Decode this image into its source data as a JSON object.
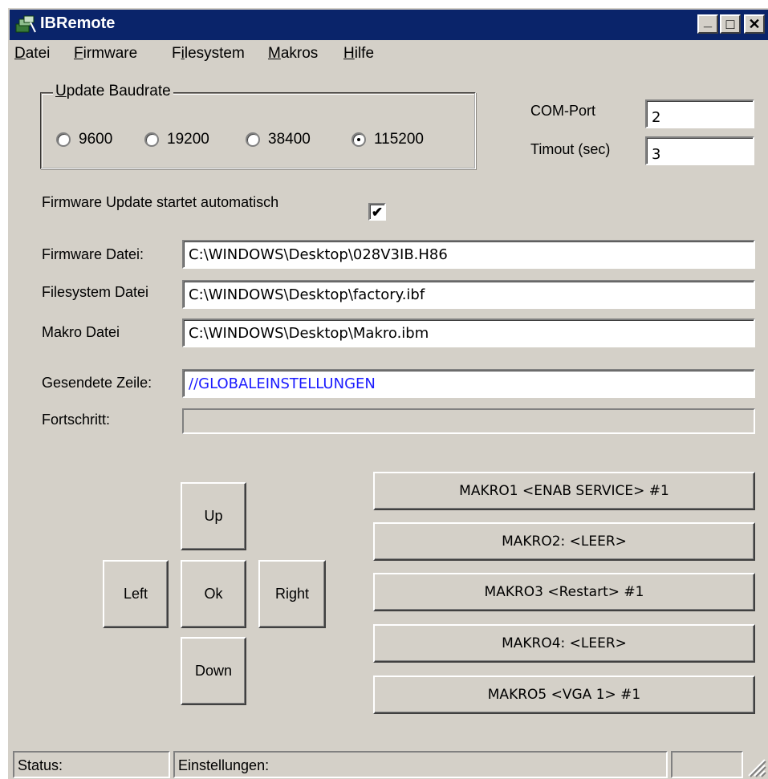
{
  "window": {
    "title": "IBRemote",
    "controls": {
      "minimize": "_",
      "maximize": "□",
      "close": "✕"
    }
  },
  "menu": {
    "items": [
      {
        "accel": "D",
        "rest": "atei"
      },
      {
        "accel": "F",
        "rest": "irmware"
      },
      {
        "pre": "F",
        "accel": "i",
        "rest": "lesystem"
      },
      {
        "accel": "M",
        "rest": "akros"
      },
      {
        "accel": "H",
        "rest": "ilfe"
      }
    ]
  },
  "baudrate": {
    "legend_accel": "U",
    "legend_rest": "pdate Baudrate",
    "options": [
      "9600",
      "19200",
      "38400",
      "115200"
    ],
    "selected": "115200"
  },
  "com": {
    "port_label": "COM-Port",
    "port_value": "2",
    "timeout_label": "Timout (sec)",
    "timeout_value": "3"
  },
  "auto_update": {
    "label": "Firmware Update startet automatisch",
    "checked": true,
    "mark": "✔"
  },
  "files": {
    "firmware_label": "Firmware Datei:",
    "firmware_value": "C:\\WINDOWS\\Desktop\\028V3IB.H86",
    "filesystem_label": "Filesystem Datei",
    "filesystem_value": "C:\\WINDOWS\\Desktop\\factory.ibf",
    "makro_label": "Makro Datei",
    "makro_value": "C:\\WINDOWS\\Desktop\\Makro.ibm"
  },
  "sent_line": {
    "label": "Gesendete Zeile:",
    "value": "//GLOBALEINSTELLUNGEN",
    "color": "#1a1aff"
  },
  "progress": {
    "label": "Fortschritt:",
    "value": 0
  },
  "nav": {
    "up": "Up",
    "left": "Left",
    "ok": "Ok",
    "right": "Right",
    "down": "Down"
  },
  "makros": [
    "MAKRO1 <ENAB SERVICE> #1",
    "MAKRO2: <LEER>",
    "MAKRO3 <Restart> #1",
    "MAKRO4: <LEER>",
    "MAKRO5 <VGA 1> #1"
  ],
  "status": {
    "status_label": "Status:",
    "settings_label": "Einstellungen:",
    "extra": ""
  },
  "colors": {
    "titlebar": "#0a246a",
    "face": "#d4d0c8"
  }
}
